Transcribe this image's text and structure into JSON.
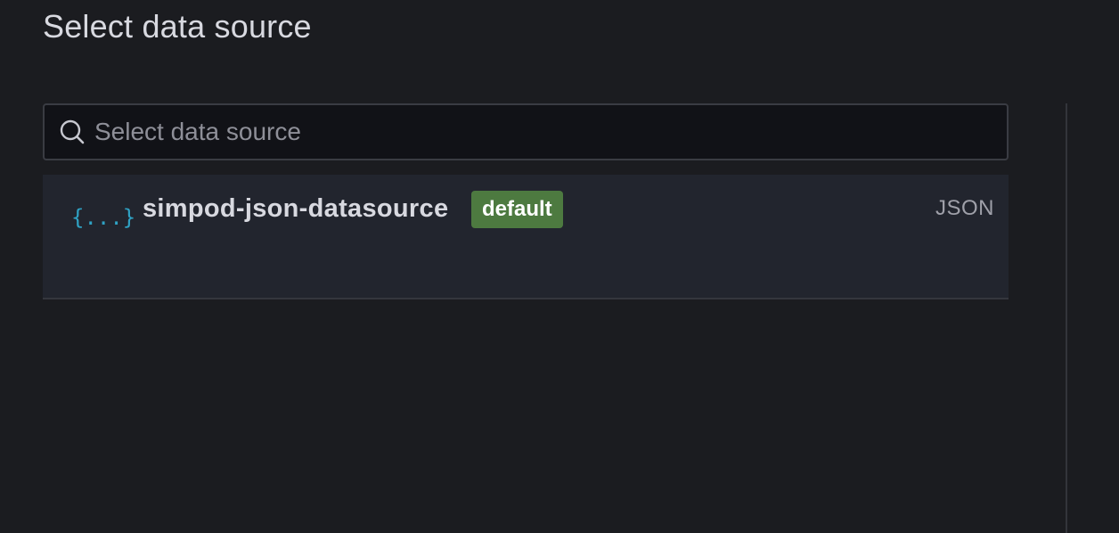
{
  "header": {
    "title": "Select data source"
  },
  "search": {
    "placeholder": "Select data source",
    "value": "",
    "icon": "search-icon"
  },
  "datasources": [
    {
      "name": "simpod-json-datasource",
      "badge": "default",
      "type": "JSON",
      "logo": "{...}",
      "logo_icon": "json-braces-icon"
    }
  ],
  "colors": {
    "background": "#1b1c20",
    "badge_default": "#4d7a40",
    "logo_accent": "#2fa2c4"
  }
}
